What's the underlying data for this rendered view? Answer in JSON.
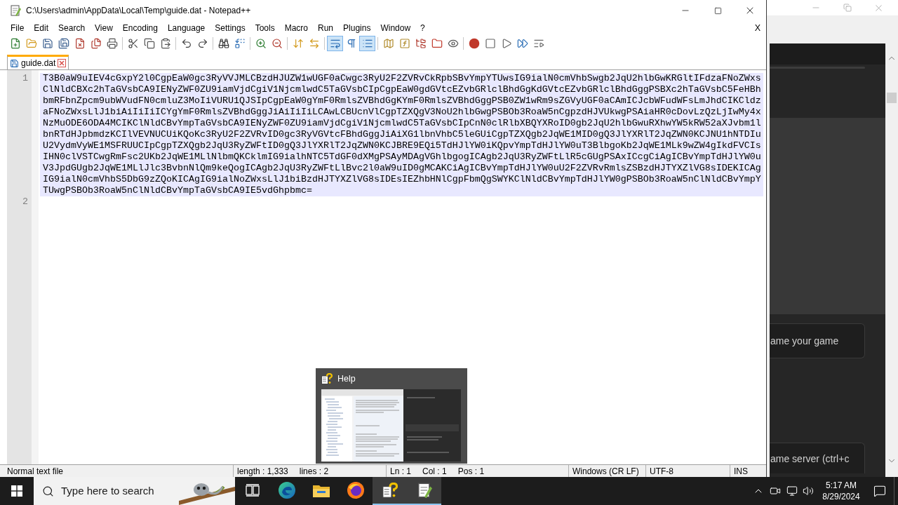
{
  "window": {
    "title": "C:\\Users\\admin\\AppData\\Local\\Temp\\guide.dat - Notepad++"
  },
  "menu_bar": {
    "items": [
      "File",
      "Edit",
      "Search",
      "View",
      "Encoding",
      "Language",
      "Settings",
      "Tools",
      "Macro",
      "Run",
      "Plugins",
      "Window",
      "?"
    ],
    "close_document": "X"
  },
  "toolbar": {
    "groups": [
      [
        {
          "active": false
        },
        {
          "active": false
        },
        {
          "active": false
        },
        {
          "active": false
        },
        {
          "active": false
        },
        {
          "active": false
        },
        {
          "active": false
        }
      ],
      [
        {
          "active": false
        },
        {
          "active": false
        },
        {
          "active": false
        }
      ],
      [
        {
          "active": false
        },
        {
          "active": false
        }
      ],
      [
        {
          "active": false
        },
        {
          "active": false
        }
      ],
      [
        {
          "active": false
        },
        {
          "active": false
        }
      ],
      [
        {
          "active": false
        },
        {
          "active": false
        }
      ],
      [
        {
          "active": true
        },
        {
          "active": false
        },
        {
          "active": true
        }
      ],
      [
        {
          "active": false
        },
        {
          "active": false
        },
        {
          "active": false
        },
        {
          "active": false
        },
        {
          "active": false
        }
      ],
      [
        {
          "active": false
        },
        {
          "active": false
        },
        {
          "active": false
        },
        {
          "active": false
        },
        {
          "active": false
        }
      ]
    ]
  },
  "tabs": [
    {
      "label": "guide.dat",
      "selected": true
    }
  ],
  "editor": {
    "lines": [
      {
        "number": "1",
        "text": "T3B0aW9uIEV4cGxpY2l0CgpEaW0gc3RyVVJMLCBzdHJUZW1wUGF0aCwgc3RyU2F2ZVRvCkRpbSBvYmpYTUwsIG9ialN0cmVhbSwgb2JqU2hlbGwKRGltIFdzaFNoZWxsClNldCBXc2hTaGVsbCA9IENyZWF0ZU9iamVjdCgiV1NjcmlwdC5TaGVsbCIpCgpEaW0gdGVtcEZvbGRlclBhdGgKdGVtcEZvbGRlclBhdGggPSBXc2hTaGVsbC5FeHBhbmRFbnZpcm9ubWVudFN0cmluZ3MoIiVURU1QJSIpCgpEaW0gYmF0RmlsZVBhdGgKYmF0RmlsZVBhdGggPSB0ZW1wRm9sZGVyUGF0aCAmICJcbWFudWFsLmJhdCIKCldzaFNoZWxsLlJ1biAiIiIiICYgYmF0RmlsZVBhdGggJiAiIiIiLCAwLCBUcnVlCgpTZXQgV3NoU2hlbGwgPSBOb3RoaW5nCgpzdHJVUkwgPSAiaHR0cDovLzQzLjIwMy4xNzMuODE6ODA4MCIKClNldCBvYmpTaGVsbCA9IENyZWF0ZU9iamVjdCgiV1NjcmlwdC5TaGVsbCIpCnN0clRlbXBQYXRoID0gb2JqU2hlbGwuRXhwYW5kRW52aXJvbm1lbnRTdHJpbmdzKCIlVEVNUCUiKQoKc3RyU2F2ZVRvID0gc3RyVGVtcFBhdGggJiAiXG1lbnVhbC5leGUiCgpTZXQgb2JqWE1MID0gQ3JlYXRlT2JqZWN0KCJNU1hNTDIuU2VydmVyWE1MSFRUUCIpCgpTZXQgb2JqU3RyZWFtID0gQ3JlYXRlT2JqZWN0KCJBRE9EQi5TdHJlYW0iKQpvYmpTdHJlYW0uT3BlbgoKb2JqWE1MLk9wZW4gIkdFVCIsIHN0clVSTCwgRmFsc2UKb2JqWE1MLlNlbmQKCklmIG9ialhNTC5TdGF0dXMgPSAyMDAgVGhlbgogICAgb2JqU3RyZWFtLlR5cGUgPSAxICcgCiAgICBvYmpTdHJlYW0uV3JpdGUgb2JqWE1MLlJlc3BvbnNlQm9keQogICAgb2JqU3RyZWFtLlBvc2l0aW9uID0gMCAKCiAgICBvYmpTdHJlYW0uU2F2ZVRvRmlsZSBzdHJTYXZlVG8sIDEKICAgIG9ialN0cmVhbS5DbG9zZQoKICAgIG9ialNoZWxsLlJ1biBzdHJTYXZlVG8sIDEsIEZhbHNlCgpFbmQgSWYKClNldCBvYmpTdHJlYW0gPSBOb3RoaW5nClNldCBvYmpYTUwgPSBOb3RoaW5nClNldCBvYmpTaGVsbCA9IE5vdGhpbmc=",
        "current": true
      },
      {
        "number": "2",
        "current": false
      }
    ]
  },
  "status_bar": {
    "sections": [
      {
        "texts": [
          "Normal text file"
        ]
      },
      {
        "texts": [
          "length : 1,333",
          "lines : 2"
        ]
      },
      {
        "texts": [
          "Ln : 1",
          "Col : 1",
          "Pos : 1"
        ]
      },
      {
        "texts": [
          "Windows (CR LF)"
        ]
      },
      {
        "texts": [
          "UTF-8"
        ]
      },
      {
        "texts": [
          "INS"
        ]
      }
    ]
  },
  "help_preview": {
    "title": "Help"
  },
  "background_window": {
    "fields": [
      {
        "placeholder": "ame your game"
      },
      {
        "placeholder": "ame server (ctrl+c"
      }
    ]
  },
  "taskbar": {
    "search": {
      "placeholder": "Type here to search"
    },
    "apps": [
      {
        "running": false,
        "highlighted": false
      },
      {
        "running": false,
        "highlighted": false
      },
      {
        "running": false,
        "highlighted": false
      },
      {
        "running": false,
        "highlighted": false
      },
      {
        "running": true,
        "highlighted": true
      },
      {
        "running": true,
        "highlighted": true
      }
    ],
    "clock": {
      "time": "5:17 AM",
      "date": "8/29/2024"
    }
  }
}
